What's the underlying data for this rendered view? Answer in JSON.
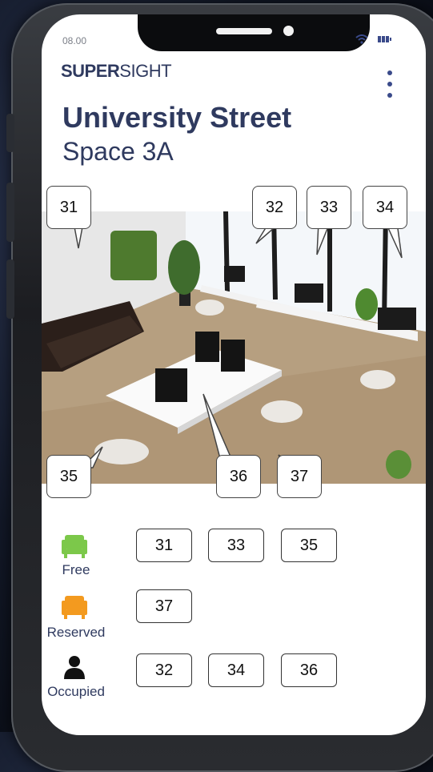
{
  "status_bar": {
    "time": "08.00"
  },
  "app": {
    "logo_bold": "SUPER",
    "logo_light": "SIGHT"
  },
  "header": {
    "title": "University Street",
    "subtitle": "Space 3A"
  },
  "desks_on_map": [
    "31",
    "32",
    "33",
    "34",
    "35",
    "36",
    "37"
  ],
  "legend": [
    {
      "label": "Free",
      "icon": "armchair-icon",
      "color": "#7cc84a",
      "desks": [
        "31",
        "33",
        "35"
      ]
    },
    {
      "label": "Reserved",
      "icon": "armchair-icon",
      "color": "#f39a1f",
      "desks": [
        "37"
      ]
    },
    {
      "label": "Occupied",
      "icon": "person-icon",
      "color": "#111111",
      "desks": [
        "32",
        "34",
        "36"
      ]
    }
  ]
}
